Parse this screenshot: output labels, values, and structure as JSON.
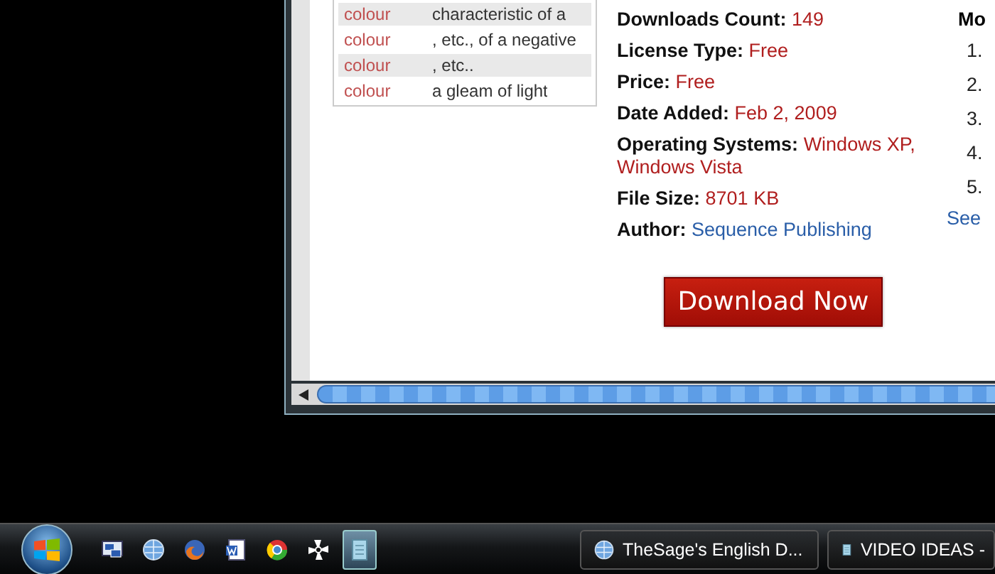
{
  "word_table": {
    "rows": [
      {
        "word": "colour",
        "definition": "characteristic of a"
      },
      {
        "word": "colour",
        "definition": ", etc., of a negative"
      },
      {
        "word": "colour",
        "definition": ", etc.."
      },
      {
        "word": "colour",
        "definition": "a gleam of light"
      }
    ]
  },
  "details": [
    {
      "label": "Downloads Count:",
      "value": "149",
      "kind": "plain"
    },
    {
      "label": "License Type:",
      "value": "Free",
      "kind": "plain"
    },
    {
      "label": "Price:",
      "value": "Free",
      "kind": "plain"
    },
    {
      "label": "Date Added:",
      "value": "Feb 2, 2009",
      "kind": "plain"
    },
    {
      "label": "Operating Systems:",
      "value": "Windows XP, Windows Vista",
      "kind": "plain"
    },
    {
      "label": "File Size:",
      "value": "8701 KB",
      "kind": "plain"
    },
    {
      "label": "Author:",
      "value": "Sequence Publishing",
      "kind": "link"
    }
  ],
  "download_button": "Download Now",
  "side_list": {
    "heading": "Mo",
    "numbers": [
      "1.",
      "2.",
      "3.",
      "4.",
      "5."
    ],
    "link": "See"
  },
  "taskbar": {
    "quick_launch": [
      {
        "kind": "desktop",
        "selected": false
      },
      {
        "kind": "globe",
        "selected": false
      },
      {
        "kind": "fox",
        "selected": false
      },
      {
        "kind": "doc",
        "selected": false
      },
      {
        "kind": "ball",
        "selected": false
      },
      {
        "kind": "fan",
        "selected": false
      },
      {
        "kind": "notepad",
        "selected": true
      }
    ],
    "tasks": [
      {
        "label": "TheSage's English D...",
        "kind": "globe"
      },
      {
        "label": "VIDEO IDEAS -",
        "kind": "notepad"
      }
    ]
  }
}
